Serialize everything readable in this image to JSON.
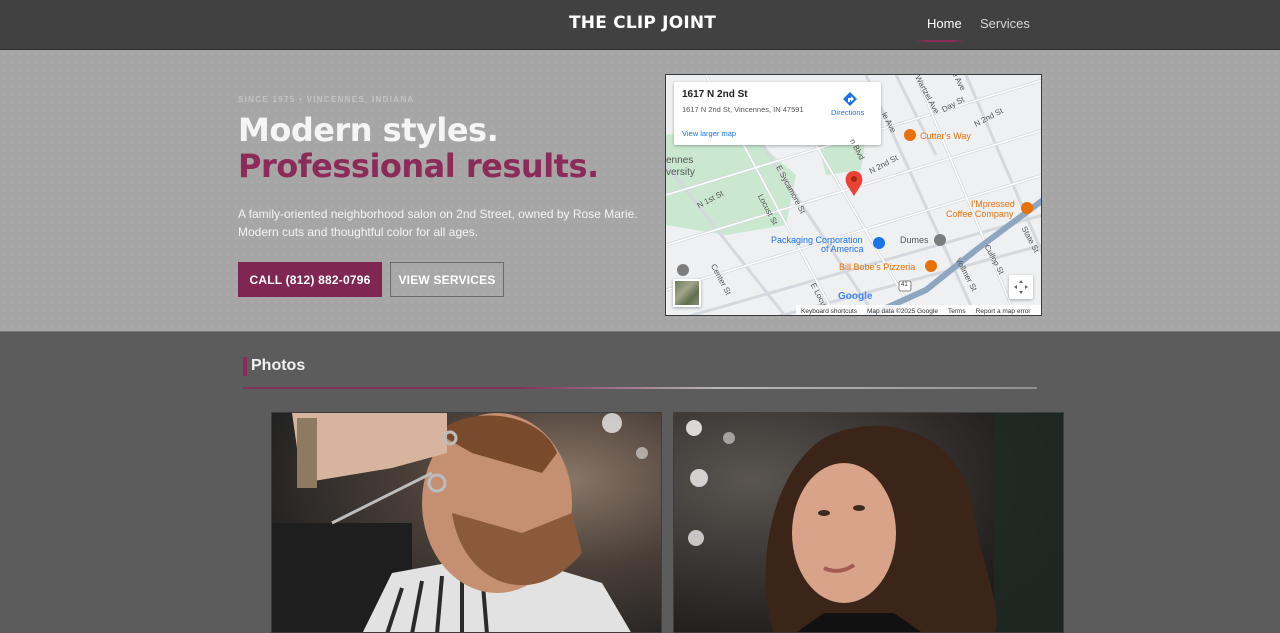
{
  "header": {
    "brand": "THE CLIP JOINT",
    "nav": [
      {
        "label": "Home",
        "active": true
      },
      {
        "label": "Services",
        "active": false
      }
    ]
  },
  "hero": {
    "eyebrow": "SINCE 1975 • VINCENNES, INDIANA",
    "headline_line1": "Modern styles.",
    "headline_line2": "Professional results.",
    "intro_line1": "A family-oriented neighborhood salon on 2nd Street, owned by Rose Marie.",
    "intro_line2": "Modern cuts and thoughtful color for all ages.",
    "call_button": "CALL (812) 882-0796",
    "services_button": "VIEW SERVICES"
  },
  "map": {
    "place_title": "1617 N 2nd St",
    "place_address": "1617 N 2nd St, Vincennes, IN 47591",
    "directions": "Directions",
    "larger_map": "View larger map",
    "street_labels": [
      "N 2nd St",
      "N 2nd St",
      "N 1st St",
      "Locust St",
      "E Sycamore St",
      "Center St",
      "E Locu",
      "Vollmer St",
      "Cullop St",
      "State St",
      "Day St",
      "Wartzel Ave",
      "tle Ave",
      "n Blvd",
      "le Ave",
      "ennes",
      "versity",
      "41"
    ],
    "pois": [
      {
        "name": "Cutter's Way",
        "kind": "orange"
      },
      {
        "name": "I'Mpressed",
        "kind": "orange"
      },
      {
        "name": "Coffee Company",
        "kind": "orange"
      },
      {
        "name": "Packaging Corporation",
        "kind": "blue"
      },
      {
        "name": "of America",
        "kind": "blue"
      },
      {
        "name": "Dumes",
        "kind": "gray"
      },
      {
        "name": "Bill Bobe's Pizzeria",
        "kind": "orange"
      }
    ],
    "google": "Google",
    "footer": [
      "Keyboard shortcuts",
      "Map data ©2025 Google",
      "Terms",
      "Report a map error"
    ]
  },
  "photos": {
    "title": "Photos",
    "items": [
      {
        "alt": "Barber trimming a bearded man's hair with scissors"
      },
      {
        "alt": "Woman with curly dark hair in salon"
      }
    ]
  },
  "colors": {
    "accent": "#8c2a58",
    "header_bg": "#414141",
    "hero_bg": "#a6a6a6",
    "page_bg": "#5c5c5c"
  }
}
